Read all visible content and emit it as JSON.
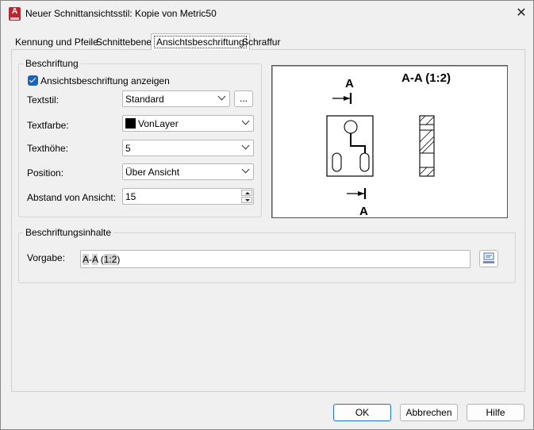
{
  "window": {
    "title": "Neuer Schnittansichtsstil: Kopie von Metric50",
    "app_icon": "autocad-logo-icon",
    "close_icon": "close-icon"
  },
  "tabs": [
    {
      "label": "Kennung und Pfeile",
      "active": false
    },
    {
      "label": "Schnittebene",
      "active": false
    },
    {
      "label": "Ansichtsbeschriftung",
      "active": true
    },
    {
      "label": "Schraffur",
      "active": false
    }
  ],
  "beschriftung": {
    "group_label": "Beschriftung",
    "show_label": {
      "text": "Ansichtsbeschriftung anzeigen",
      "checked": true
    },
    "textstil": {
      "label": "Textstil:",
      "value": "Standard",
      "browse": "..."
    },
    "textfarbe": {
      "label": "Textfarbe:",
      "value": "VonLayer",
      "swatch": "#000000"
    },
    "texthoehe": {
      "label": "Texthöhe:",
      "value": "5"
    },
    "position": {
      "label": "Position:",
      "value": "Über Ansicht"
    },
    "abstand": {
      "label": "Abstand von Ansicht:",
      "value": "15"
    }
  },
  "preview": {
    "title": "A-A (1:2)",
    "top_marker": "A",
    "bottom_marker": "A"
  },
  "inhalte": {
    "group_label": "Beschriftungsinhalte",
    "vorgabe_label": "Vorgabe:",
    "vorgabe_parts": [
      "A",
      "-",
      "A",
      " (",
      "1:2",
      ")"
    ],
    "field_icon": "insert-field-icon"
  },
  "buttons": {
    "ok": "OK",
    "cancel": "Abbrechen",
    "help": "Hilfe"
  }
}
